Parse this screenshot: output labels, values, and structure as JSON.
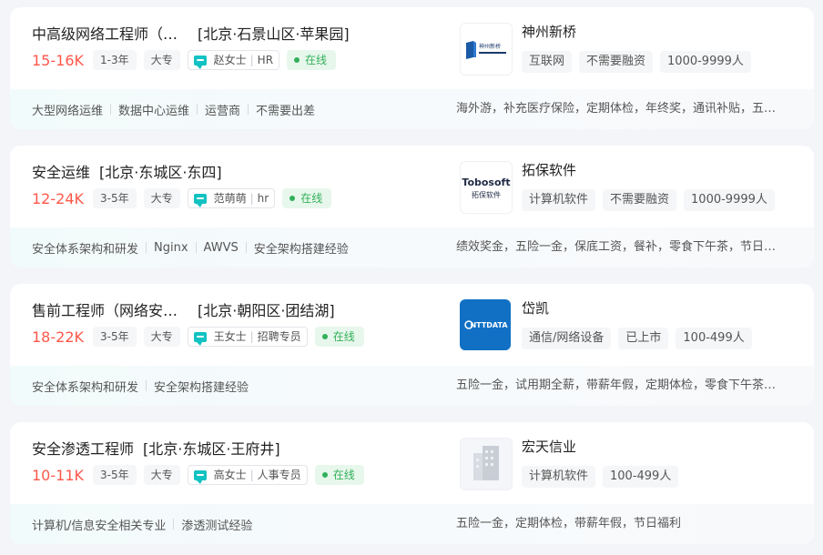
{
  "jobs": [
    {
      "name": "中高级网络工程师（…",
      "area": "[北京·石景山区·苹果园]",
      "salary": "15-16K",
      "experience": "1-3年",
      "degree": "大专",
      "hr_name": "赵女士",
      "hr_title": "HR",
      "status": "在线",
      "skills": [
        "大型网络运维",
        "数据中心运维",
        "运营商",
        "不需要出差"
      ],
      "company": {
        "name": "神州新桥",
        "logo_text": "神州新桥",
        "tags": [
          "互联网",
          "不需要融资",
          "1000-9999人"
        ]
      },
      "welfare": "海外游，补充医疗保险，定期体检，年终奖，通讯补贴，五险一金"
    },
    {
      "name": "安全运维",
      "area": "[北京·东城区·东四]",
      "salary": "12-24K",
      "experience": "3-5年",
      "degree": "大专",
      "hr_name": "范萌萌",
      "hr_title": "hr",
      "status": "在线",
      "skills": [
        "安全体系架构和研发",
        "Nginx",
        "AWVS",
        "安全架构搭建经验"
      ],
      "company": {
        "name": "拓保软件",
        "logo_text": "Tobosoft",
        "logo_sub": "拓保软件",
        "tags": [
          "计算机软件",
          "不需要融资",
          "1000-9999人"
        ]
      },
      "welfare": "绩效奖金，五险一金，保底工资，餐补，零食下午茶，节日福利"
    },
    {
      "name": "售前工程师（网络安…",
      "area": "[北京·朝阳区·团结湖]",
      "salary": "18-22K",
      "experience": "3-5年",
      "degree": "大专",
      "hr_name": "王女士",
      "hr_title": "招聘专员",
      "status": "在线",
      "skills": [
        "安全体系架构和研发",
        "安全架构搭建经验"
      ],
      "company": {
        "name": "岱凯",
        "logo_text": "NTTDATA",
        "tags": [
          "通信/网络设备",
          "已上市",
          "100-499人"
        ]
      },
      "welfare": "五险一金，试用期全薪，带薪年假，定期体检，零食下午茶，节日福利"
    },
    {
      "name": "安全渗透工程师",
      "area": "[北京·东城区·王府井]",
      "salary": "10-11K",
      "experience": "3-5年",
      "degree": "大专",
      "hr_name": "高女士",
      "hr_title": "人事专员",
      "status": "在线",
      "skills": [
        "计算机/信息安全相关专业",
        "渗透测试经验"
      ],
      "company": {
        "name": "宏天信业",
        "tags": [
          "计算机软件",
          "100-499人"
        ]
      },
      "welfare": "五险一金，定期体检，带薪年假，节日福利"
    }
  ],
  "colors": {
    "salary": "#fe574a",
    "online": "#31b05a",
    "chat_icon": "#13c2c2",
    "nttdata_blue": "#1170c4"
  }
}
